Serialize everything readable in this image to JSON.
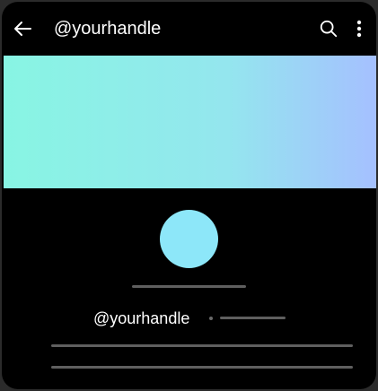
{
  "app_bar": {
    "title": "@yourhandle",
    "back_icon": "arrow-left-icon",
    "search_icon": "search-icon",
    "more_icon": "more-vertical-icon"
  },
  "profile": {
    "handle": "@yourhandle"
  },
  "colors": {
    "background": "#000000",
    "banner_start": "#88f5e3",
    "banner_end": "#a5c0ff",
    "avatar": "#8de7f9",
    "placeholder": "#5f5f5f"
  }
}
